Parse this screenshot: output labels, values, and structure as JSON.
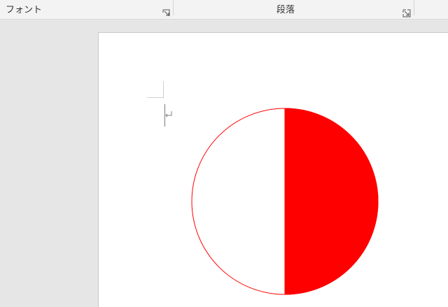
{
  "ribbon": {
    "groups": [
      {
        "label": "フォント",
        "launcher_icon": "dialog-launcher-icon"
      },
      {
        "label": "段落",
        "launcher_icon": "dialog-launcher-icon"
      }
    ]
  },
  "document": {
    "shape": {
      "type": "circle-half-filled",
      "fill_color": "#ff0000",
      "stroke_color": "#ff0000",
      "fill_side": "right"
    },
    "paragraph_mark_icon": "paragraph-mark-icon"
  },
  "colors": {
    "ribbon_bg": "#f3f3f3",
    "workspace_bg": "#e6e6e6",
    "page_bg": "#ffffff",
    "accent_red": "#ff0000"
  }
}
